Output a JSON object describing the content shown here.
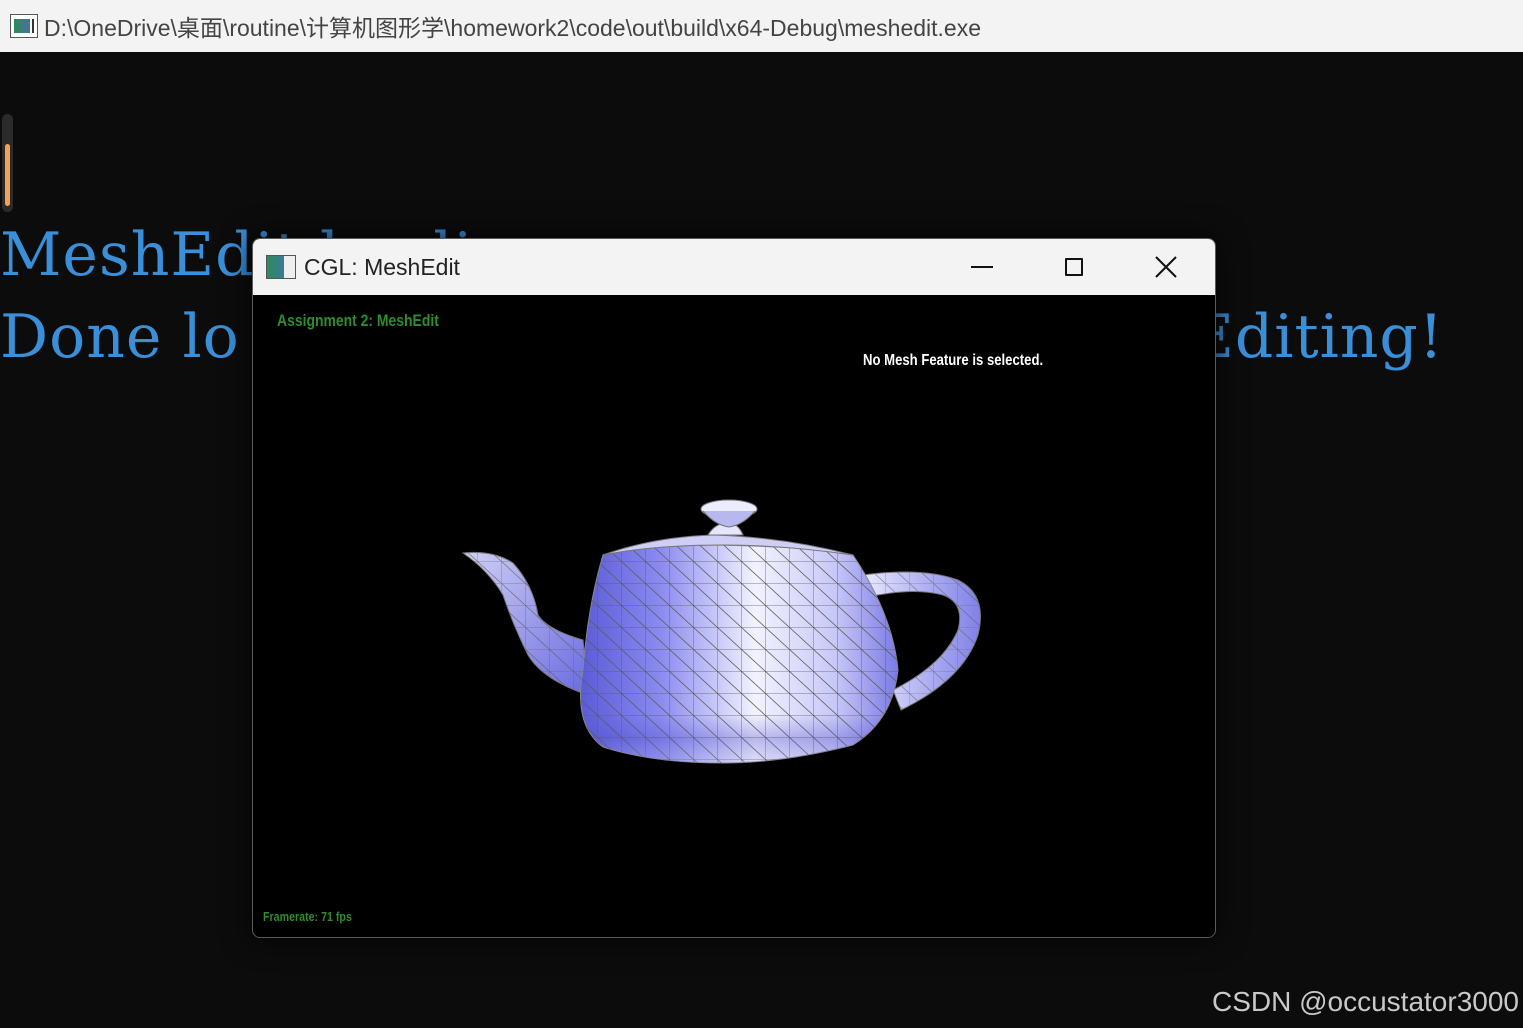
{
  "console_window": {
    "title": "D:\\OneDrive\\桌面\\routine\\计算机图形学\\homework2\\code\\out\\build\\x64-Debug\\meshedit.exe",
    "lines": [
      "MeshEdit loading...",
      "Done loading. Begin Editing!"
    ],
    "line2_visible_left": "Done lo",
    "line2_visible_right": " Editing!",
    "line1_visible": "MeshEdit loadi",
    "scroll_position": 0.3
  },
  "cgl_window": {
    "title": "CGL: MeshEdit",
    "controls": {
      "minimize": "minimize",
      "maximize": "maximize",
      "close": "close"
    },
    "hud": {
      "assignment_label": "Assignment 2: MeshEdit",
      "selection_status": "No Mesh Feature is selected.",
      "framerate": "Framerate: 71 fps"
    },
    "mesh": {
      "model": "teapot",
      "fill_color": "#8e8ef0",
      "highlight_color": "#eeeeff",
      "wire_color": "#606060"
    }
  },
  "watermark": "CSDN @occustator3000",
  "colors": {
    "console_text": "#3a8fd9",
    "hud_green": "#2f8c2f",
    "scroll_accent": "#f5a05a"
  }
}
